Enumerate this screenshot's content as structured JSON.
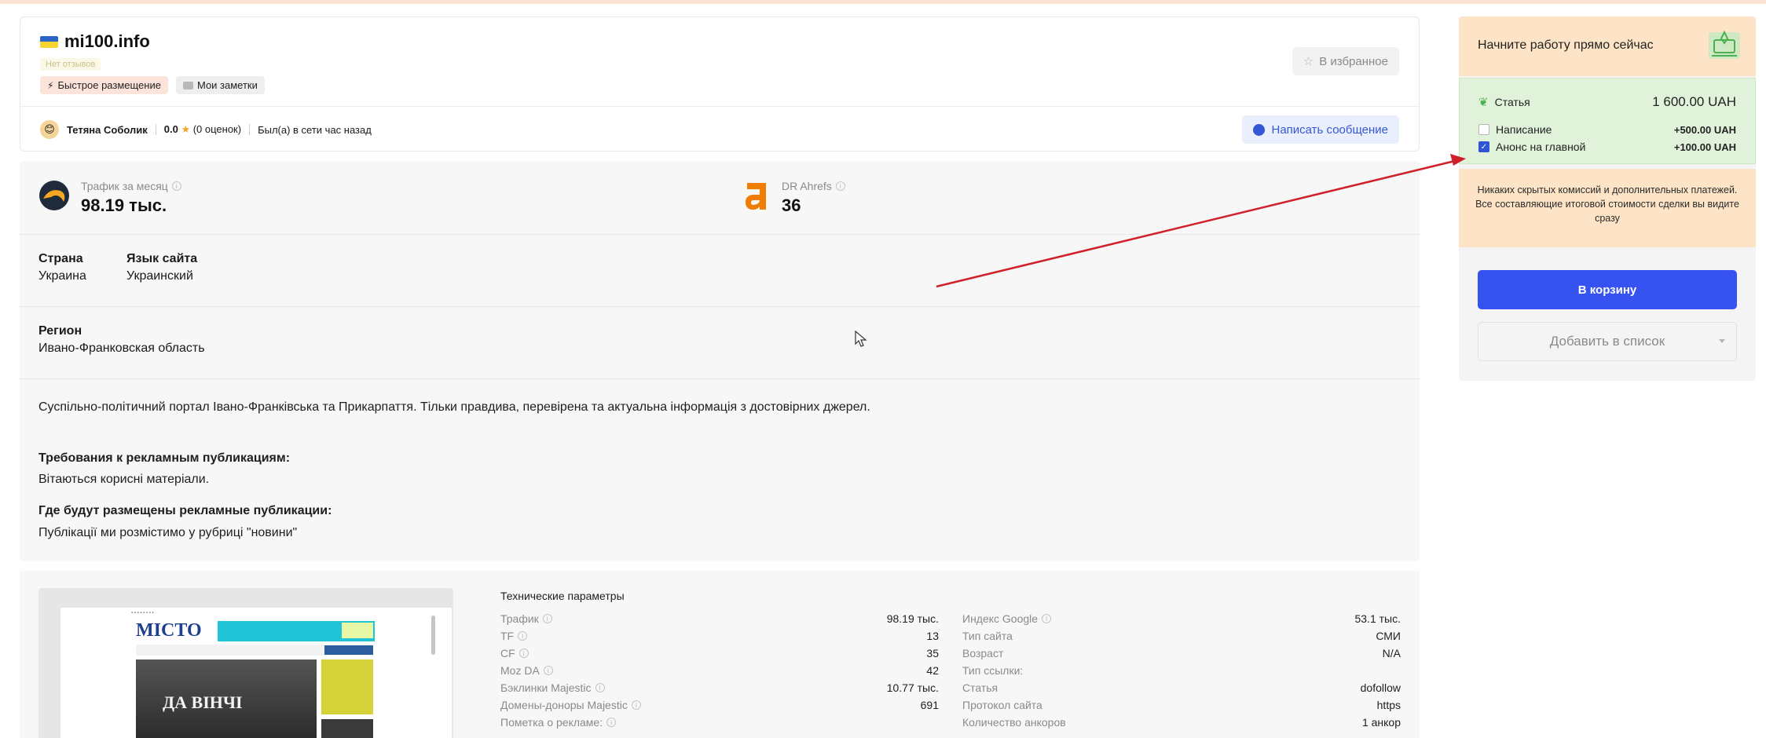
{
  "site": {
    "name": "mi100.info",
    "no_reviews": "Нет отзывов",
    "badge_fast": "Быстрое размещение",
    "badge_notes": "Мои заметки",
    "favorite_label": "В избранное"
  },
  "seller": {
    "name": "Тетяна Соболик",
    "rating": "0.0",
    "rating_count": "(0 оценок)",
    "last_seen": "Был(а) в сети час назад",
    "message_label": "Написать сообщение"
  },
  "metrics": {
    "traffic_label": "Трафик за месяц",
    "traffic_value": "98.19 тыс.",
    "dr_label": "DR Ahrefs",
    "dr_value": "36"
  },
  "info": {
    "country_label": "Страна",
    "country_value": "Украина",
    "lang_label": "Язык сайта",
    "lang_value": "Украинский",
    "region_label": "Регион",
    "region_value": "Ивано-Франковская область",
    "description": "Суспільно-політичний портал Івано-Франківська та Прикарпаття. Тільки правдива, перевірена та актуальна інформація з достовірних джерел.",
    "req_label": "Требования к рекламным публикациям:",
    "req_value": "Вітаються корисні матеріали.",
    "where_label": "Где будут размещены рекламные публикации:",
    "where_value": "Публікації ми розмістимо у рубриці \"новини\""
  },
  "tech": {
    "title": "Технические параметры",
    "left": [
      {
        "k": "Трафик",
        "v": "98.19 тыс.",
        "i": true
      },
      {
        "k": "TF",
        "v": "13",
        "i": true
      },
      {
        "k": "CF",
        "v": "35",
        "i": true
      },
      {
        "k": "Moz DA",
        "v": "42",
        "i": true
      },
      {
        "k": "Бэклинки Majestic",
        "v": "10.77 тыс.",
        "i": true
      },
      {
        "k": "Домены-доноры Majestic",
        "v": "691",
        "i": true
      },
      {
        "k": "Пометка о рекламе:",
        "v": "",
        "i": true
      }
    ],
    "right": [
      {
        "k": "Индекс Google",
        "v": "53.1 тыс.",
        "i": true
      },
      {
        "k": "Тип сайта",
        "v": "СМИ",
        "i": false
      },
      {
        "k": "Возраст",
        "v": "N/A",
        "i": false
      },
      {
        "k": "Тип ссылки:",
        "v": "",
        "i": false
      },
      {
        "k": "Статья",
        "v": "dofollow",
        "i": false
      },
      {
        "k": "Протокол сайта",
        "v": "https",
        "i": false
      },
      {
        "k": "Количество анкоров",
        "v": "1 анкор",
        "i": false
      }
    ]
  },
  "screenshot": {
    "logo": "МІСТО",
    "headline": "ДА ВІНЧІ"
  },
  "sidebar": {
    "start_text": "Начните работу прямо сейчас",
    "article_label": "Статья",
    "article_price": "1 600.00 UAH",
    "writing_label": "Написание",
    "writing_price": "+500.00 UAH",
    "writing_checked": false,
    "anons_label": "Анонс на главной",
    "anons_price": "+100.00 UAH",
    "anons_checked": true,
    "note": "Никаких скрытых комиссий и дополнительных платежей. Все составляющие итоговой стоимости сделки вы видите сразу",
    "cart_label": "В корзину",
    "list_label": "Добавить в список"
  },
  "colors": {
    "accent": "#3652f0",
    "arrow": "#d0202a",
    "price_bg": "#e1f2da",
    "warm_bg": "#fde4c6"
  }
}
